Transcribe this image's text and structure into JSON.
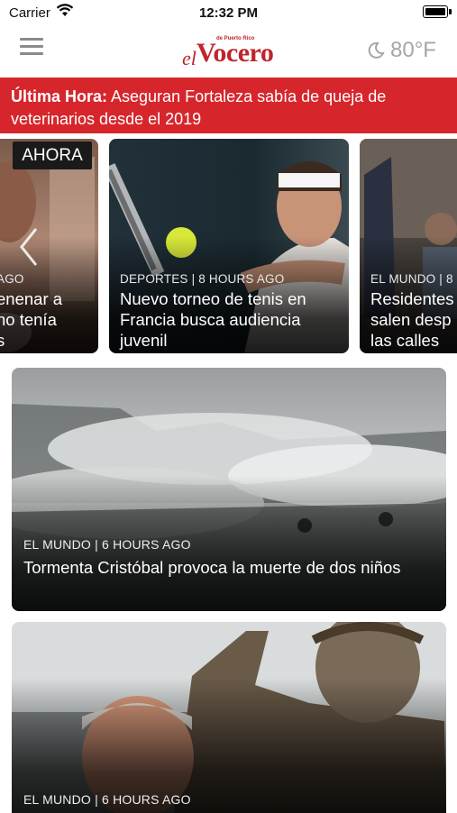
{
  "status_bar": {
    "carrier": "Carrier",
    "time": "12:32 PM"
  },
  "nav": {
    "menu_icon": "hamburger-menu-icon",
    "logo": {
      "el": "el",
      "name": "Vocero",
      "tagline": "de Puerto Rico"
    },
    "weather": {
      "icon": "moon-icon",
      "temperature": "80°F"
    }
  },
  "breaking": {
    "label": "Última Hora:",
    "text": " Aseguran Fortaleza sabía de queja de veterinarios desde el 2019"
  },
  "carousel": {
    "badge": "AHORA",
    "cards": [
      {
        "meta": "AGO",
        "headline_lines": [
          "enenar a",
          "no tenía",
          "s"
        ]
      },
      {
        "meta": "DEPORTES | 8 HOURS AGO",
        "headline_lines": [
          "Nuevo torneo de tenis en",
          "Francia busca audiencia",
          "juvenil"
        ]
      },
      {
        "meta": "EL MUNDO | 8",
        "headline_lines": [
          "Residentes",
          "salen desp",
          "las calles"
        ]
      }
    ]
  },
  "stories": [
    {
      "meta": "EL MUNDO | 6 HOURS AGO",
      "headline": "Tormenta Cristóbal provoca la muerte de dos niños"
    },
    {
      "meta": "EL MUNDO | 6 HOURS AGO"
    }
  ],
  "colors": {
    "brand_red": "#d6262c",
    "logo_red": "#c0242c",
    "muted": "#a6a6a6"
  }
}
